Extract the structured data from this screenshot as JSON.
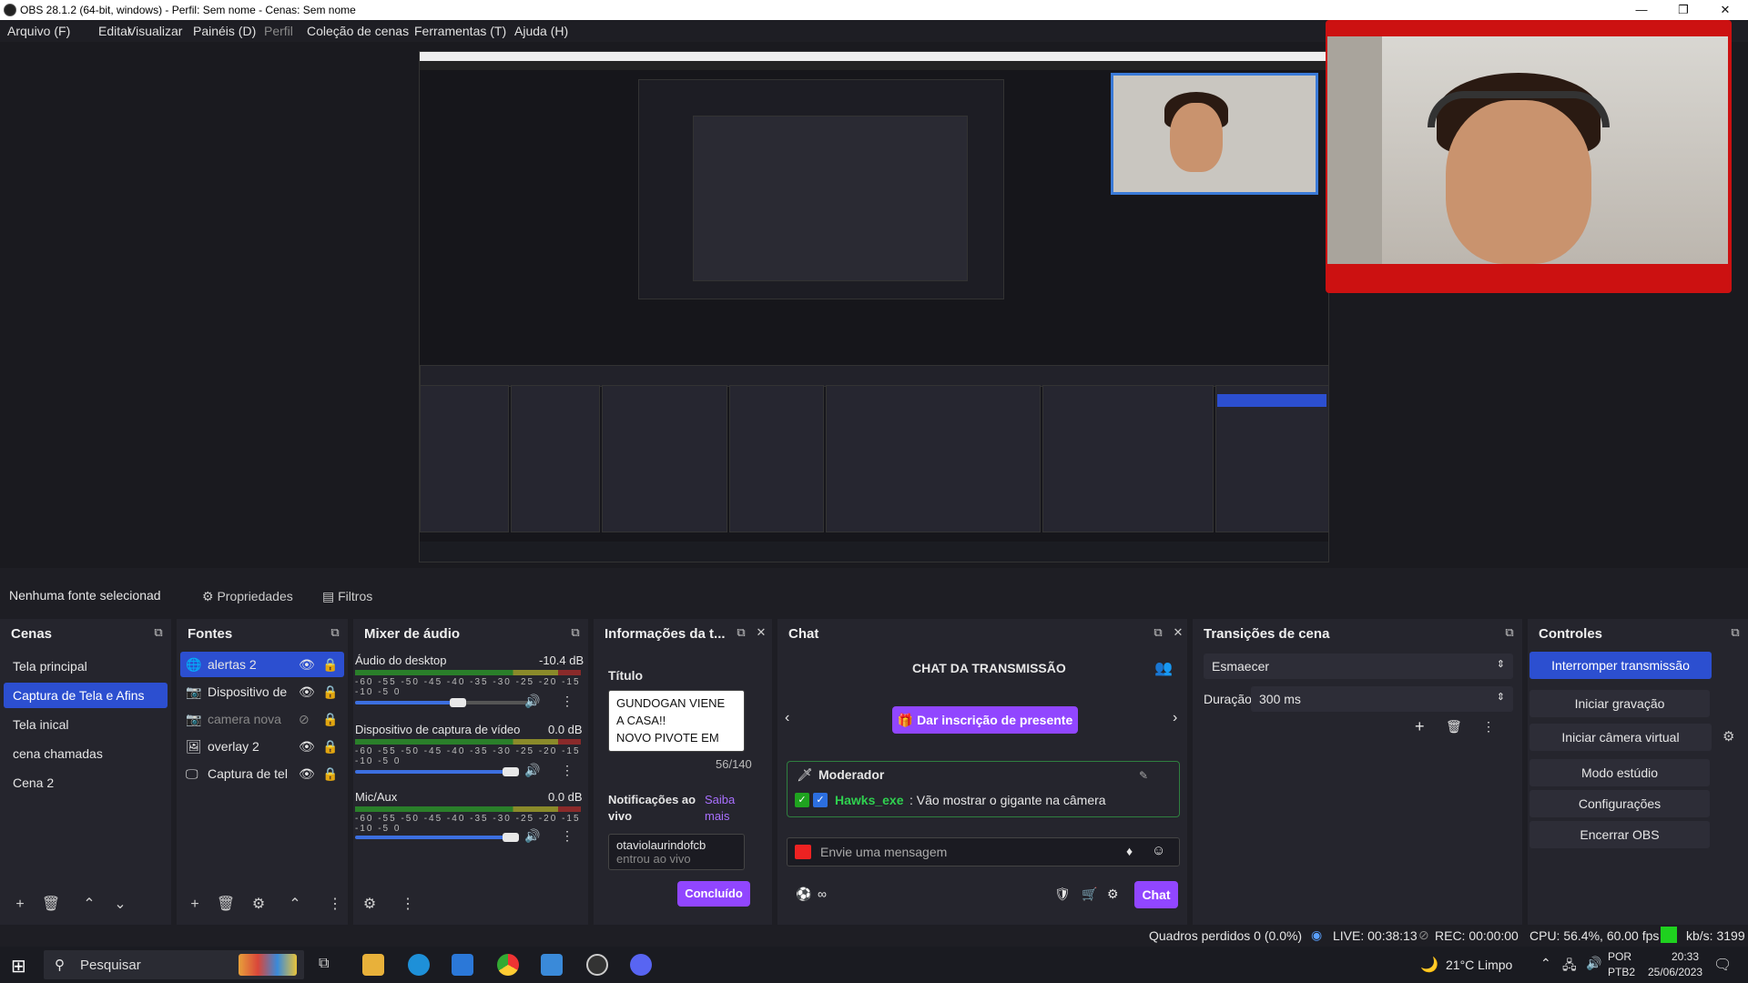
{
  "window": {
    "title": "OBS 28.1.2 (64-bit, windows) - Perfil: Sem nome - Cenas: Sem nome",
    "minimize": "—",
    "maximize": "❐",
    "close": "✕"
  },
  "menu": [
    "Arquivo (F)",
    "Editar",
    "Visualizar",
    "Painéis (D)",
    "Perfil",
    "Coleção de cenas",
    "Ferramentas (T)",
    "Ajuda (H)"
  ],
  "toolbar": {
    "no_source": "Nenhuma fonte selecionad",
    "properties": "Propriedades",
    "filters": "Filtros"
  },
  "scenes": {
    "title": "Cenas",
    "items": [
      "Tela principal",
      "Captura de Tela e Afins",
      "Tela inical",
      "cena chamadas",
      "Cena 2"
    ],
    "selected": 1
  },
  "sources": {
    "title": "Fontes",
    "items": [
      {
        "label": "alertas 2",
        "icon": "browser-icon"
      },
      {
        "label": "Dispositivo de",
        "icon": "camera-icon"
      },
      {
        "label": "camera nova",
        "icon": "camera-icon"
      },
      {
        "label": "overlay 2",
        "icon": "image-icon"
      },
      {
        "label": "Captura de tel",
        "icon": "monitor-icon"
      }
    ]
  },
  "mixer": {
    "title": "Mixer de áudio",
    "scale": "-60 -55 -50 -45 -40 -35 -30 -25 -20 -15 -10 -5 0",
    "channels": [
      {
        "name": "Áudio do desktop",
        "db": "-10.4 dB",
        "level": 0.82
      },
      {
        "name": "Dispositivo de captura de vídeo",
        "db": "0.0 dB",
        "level": 1.0
      },
      {
        "name": "Mic/Aux",
        "db": "0.0 dB",
        "level": 1.0
      }
    ]
  },
  "info": {
    "title": "Informações da t...",
    "field_title": "Título",
    "title_text": [
      "GUNDOGAN VIENE",
      "A CASA!!",
      "NOVO PIVOTE EM"
    ],
    "counter": "56/140",
    "notifications": "Notificações ao vivo",
    "learn_more": "Saiba mais",
    "user": "otaviolaurindofcb",
    "user_sub": "entrou ao vivo",
    "done": "Concluído"
  },
  "chat": {
    "title": "Chat",
    "header": "CHAT DA TRANSMISSÃO",
    "gift_sub": "Dar inscrição de presente",
    "moderator": "Moderador",
    "message_user": "Hawks_exe",
    "message_text": ": Vão mostrar o gigante na câmera",
    "input_placeholder": "Envie uma mensagem",
    "points": "∞",
    "send": "Chat"
  },
  "transitions": {
    "title": "Transições de cena",
    "selected": "Esmaecer",
    "duration_label": "Duração",
    "duration_value": "300 ms"
  },
  "controls": {
    "title": "Controles",
    "buttons": [
      "Interromper transmissão",
      "Iniciar gravação",
      "Iniciar câmera virtual",
      "Modo estúdio",
      "Configurações",
      "Encerrar OBS"
    ]
  },
  "status": {
    "dropped": "Quadros perdidos 0 (0.0%)",
    "live": "LIVE: 00:38:13",
    "rec": "REC: 00:00:00",
    "cpu": "CPU: 56.4%, 60.00 fps",
    "kbs": "kb/s: 3199"
  },
  "taskbar": {
    "search": "Pesquisar",
    "weather": "21°C  Limpo",
    "lang": "POR",
    "layout": "PTB2",
    "time": "20:33",
    "date": "25/06/2023"
  },
  "colors": {
    "accent": "#2c4fd0",
    "twitch": "#9146ff",
    "live_green": "#1fd11f"
  }
}
